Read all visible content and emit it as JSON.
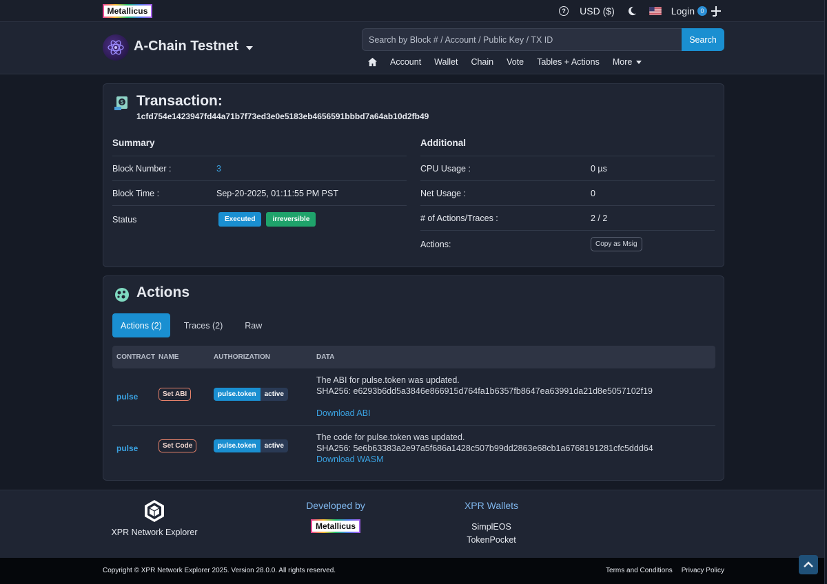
{
  "topbar": {
    "brand": "Metallicus",
    "currency": "USD ($)",
    "login": "Login",
    "login_badge": "0"
  },
  "header": {
    "chain_name": "A-Chain Testnet",
    "search_placeholder": "Search by Block # / Account / Public Key / TX ID",
    "search_button": "Search",
    "nav": [
      "Account",
      "Wallet",
      "Chain",
      "Vote",
      "Tables + Actions",
      "More"
    ]
  },
  "transaction": {
    "title": "Transaction:",
    "hash": "1cfd754e1423947fd44a71b7f73ed3e0e5183eb4656591bbbd7a64ab10d2fb49",
    "summary": {
      "title": "Summary",
      "block_number_label": "Block Number :",
      "block_number": "3",
      "block_time_label": "Block Time :",
      "block_time": "Sep-20-2025, 01:11:55 PM PST",
      "status_label": "Status",
      "status_executed": "Executed",
      "status_irreversible": "irreversible"
    },
    "additional": {
      "title": "Additional",
      "cpu_label": "CPU Usage :",
      "cpu": "0 µs",
      "net_label": "Net Usage :",
      "net": "0",
      "actions_traces_label": "# of Actions/Traces :",
      "actions_traces": "2 / 2",
      "actions_label": "Actions:",
      "copy_msig": "Copy as Msig"
    }
  },
  "actions": {
    "title": "Actions",
    "tabs": [
      "Actions (2)",
      "Traces (2)",
      "Raw"
    ],
    "columns": [
      "CONTRACT",
      "NAME",
      "AUTHORIZATION",
      "DATA"
    ],
    "rows": [
      {
        "contract": "pulse",
        "name": "Set ABI",
        "actor": "pulse.token",
        "permission": "active",
        "line1": "The ABI for pulse.token was updated.",
        "line2": "SHA256: e6293b6dd5a3846e866915d764fa1b6357fb8647ea63991da21d8e5057102f19",
        "download": "Download ABI"
      },
      {
        "contract": "pulse",
        "name": "Set Code",
        "actor": "pulse.token",
        "permission": "active",
        "line1": "The code for pulse.token was updated.",
        "line2": "SHA256: 5e6b63383a2e97a5f686a1428c507b99dd2863e68cb1a6768191281cfc5ddd64",
        "download": "Download WASM"
      }
    ]
  },
  "footer": {
    "explorer": "XPR Network Explorer",
    "developed_by": "Developed by",
    "brand": "Metallicus",
    "wallets_title": "XPR Wallets",
    "wallets": [
      "SimplEOS",
      "TokenPocket"
    ],
    "copyright": "Copyright © XPR Network Explorer 2025. Version 28.0.0. All rights reserved.",
    "terms": "Terms and Conditions",
    "privacy": "Privacy Policy"
  }
}
